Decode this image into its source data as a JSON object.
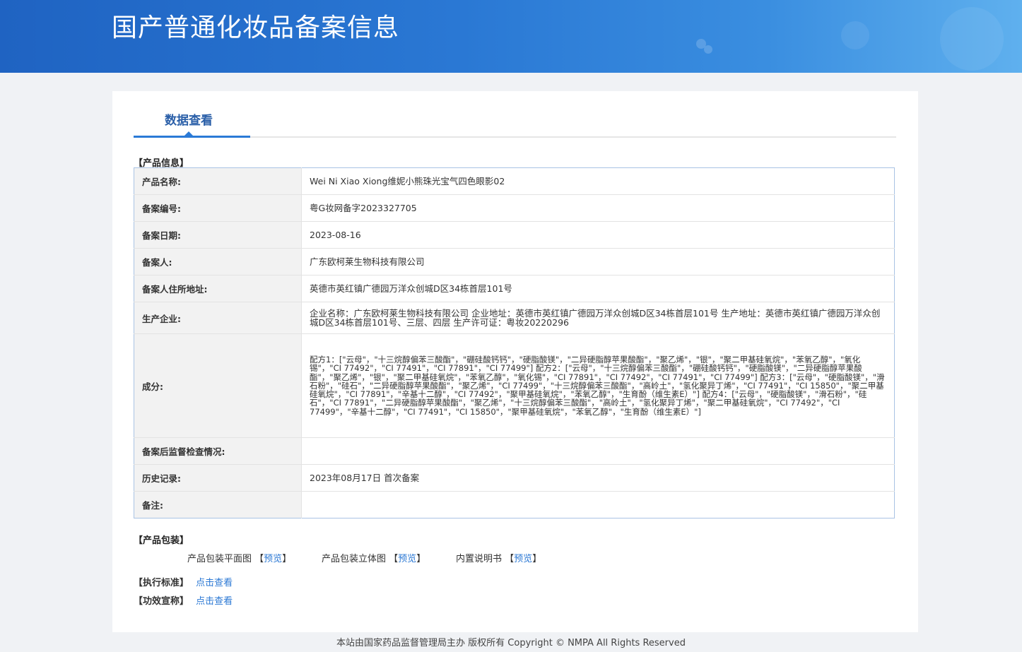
{
  "banner": {
    "title": "国产普通化妆品备案信息"
  },
  "tab": {
    "label": "数据查看"
  },
  "product_info": {
    "heading": "【产品信息】",
    "rows": [
      {
        "label": "产品名称:",
        "value": "Wei Ni Xiao Xiong维妮小熊珠光宝气四色眼影02"
      },
      {
        "label": "备案编号:",
        "value": "粤G妆网备字2023327705"
      },
      {
        "label": "备案日期:",
        "value": "2023-08-16"
      },
      {
        "label": "备案人:",
        "value": "广东欧柯莱生物科技有限公司"
      },
      {
        "label": "备案人住所地址:",
        "value": "英德市英红镇广德园万洋众创城D区34栋首层101号"
      },
      {
        "label": "生产企业:",
        "value": "企业名称：广东欧柯莱生物科技有限公司 企业地址：英德市英红镇广德园万洋众创城D区34栋首层101号 生产地址：英德市英红镇广德园万洋众创城D区34栋首层101号、三层、四层 生产许可证：粤妆20220296"
      },
      {
        "label": "成分:",
        "value": "配方1：[\"云母\"，\"十三烷醇偏苯三酸酯\"，\"硼硅酸钙钙\"，\"硬脂酸镁\"，\"二异硬脂醇苹果酸酯\"，\"聚乙烯\"，\"银\"，\"聚二甲基硅氧烷\"，\"苯氧乙醇\"，\"氧化锡\"，\"CI 77492\"，\"CI 77491\"，\"CI 77891\"，\"CI 77499\"] 配方2：[\"云母\"，\"十三烷醇偏苯三酸酯\"，\"硼硅酸钙钙\"，\"硬脂酸镁\"，\"二异硬脂醇苹果酸酯\"，\"聚乙烯\"，\"银\"，\"聚二甲基硅氧烷\"，\"苯氧乙醇\"，\"氧化锡\"，\"CI 77891\"，\"CI 77492\"，\"CI 77491\"，\"CI 77499\"] 配方3：[\"云母\"，\"硬脂酸镁\"，\"滑石粉\"，\"硅石\"，\"二异硬脂醇苹果酸酯\"，\"聚乙烯\"，\"CI 77499\"，\"十三烷醇偏苯三酸酯\"，\"高岭土\"，\"氢化聚异丁烯\"，\"CI 77491\"，\"CI 15850\"，\"聚二甲基硅氧烷\"，\"CI 77891\"，\"辛基十二醇\"，\"CI 77492\"，\"聚甲基硅氧烷\"，\"苯氧乙醇\"，\"生育酚（维生素E）\"] 配方4：[\"云母\"，\"硬脂酸镁\"，\"滑石粉\"，\"硅石\"，\"CI 77891\"，\"二异硬脂醇苹果酸酯\"，\"聚乙烯\"，\"十三烷醇偏苯三酸酯\"，\"高岭土\"，\"氢化聚异丁烯\"，\"聚二甲基硅氧烷\"，\"CI 77492\"，\"CI 77499\"，\"辛基十二醇\"，\"CI 77491\"，\"CI 15850\"，\"聚甲基硅氧烷\"，\"苯氧乙醇\"，\"生育酚（维生素E）\"]"
      },
      {
        "label": "备案后监督检查情况:",
        "value": ""
      },
      {
        "label": "历史记录:",
        "value": "2023年08月17日 首次备案"
      },
      {
        "label": "备注:",
        "value": ""
      }
    ]
  },
  "packaging": {
    "heading": "【产品包装】",
    "items": [
      {
        "label": "产品包装平面图",
        "open": "【",
        "link": "预览",
        "close": "】"
      },
      {
        "label": "产品包装立体图",
        "open": "【",
        "link": "预览",
        "close": "】"
      },
      {
        "label": "内置说明书",
        "open": "【",
        "link": "预览",
        "close": "】"
      }
    ]
  },
  "standard": {
    "heading": "【执行标准】",
    "link": "点击查看"
  },
  "claims": {
    "heading": "【功效宣称】",
    "link": "点击查看"
  },
  "footer": {
    "text": "本站由国家药品监督管理局主办 版权所有 Copyright © NMPA All Rights Reserved"
  },
  "colors": {
    "banner": "#2a78d4",
    "accent": "#2b7ad6",
    "link": "#2b78d4",
    "label_bg": "#f2f2f2"
  }
}
